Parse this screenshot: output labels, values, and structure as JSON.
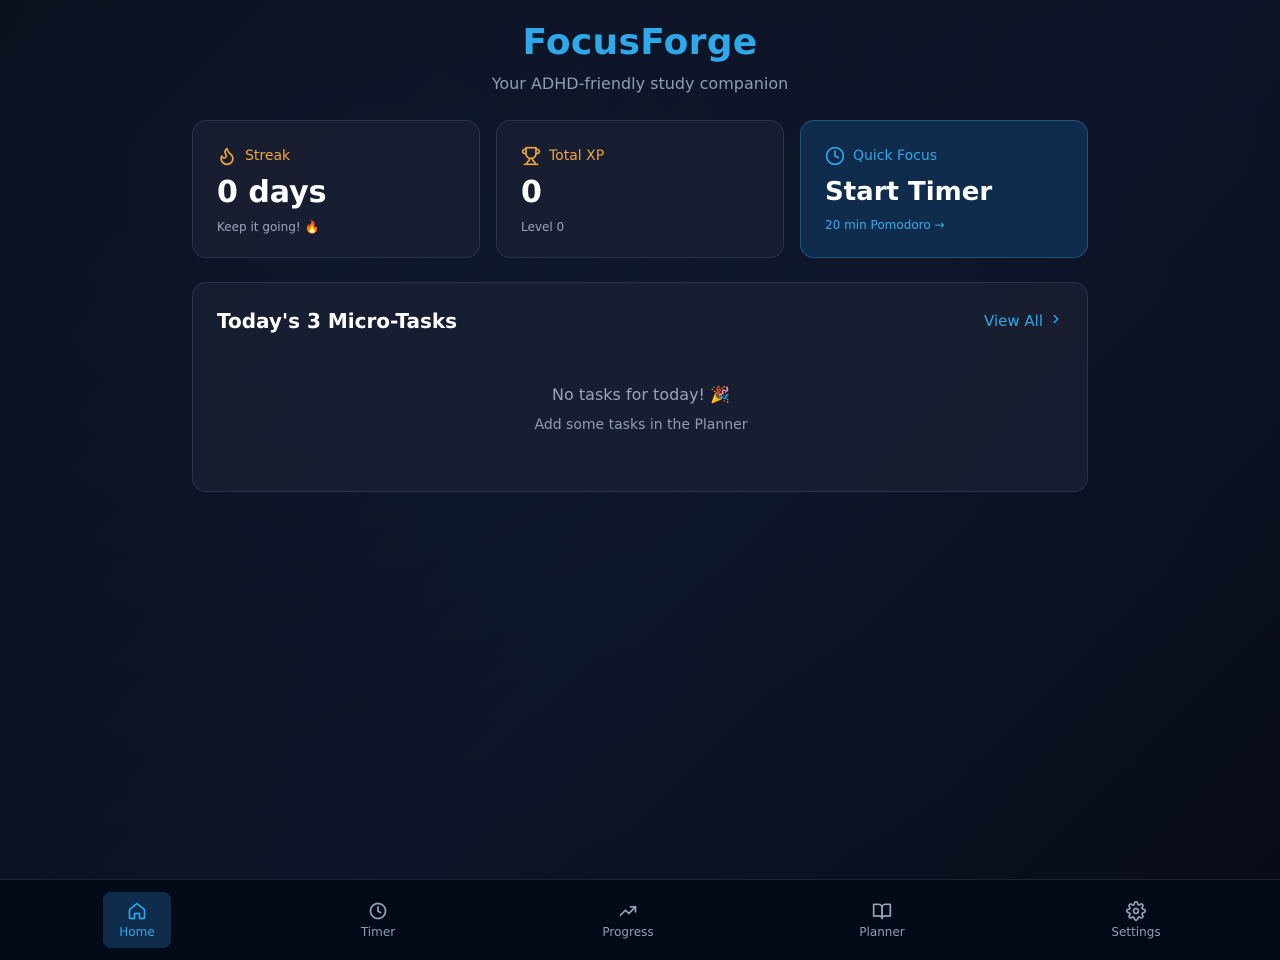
{
  "header": {
    "title": "FocusForge",
    "subtitle": "Your ADHD-friendly study companion"
  },
  "cards": {
    "streak": {
      "icon": "flame-icon",
      "label": "Streak",
      "value": "0 days",
      "note": "Keep it going! 🔥",
      "color": "#f0a43a"
    },
    "xp": {
      "icon": "trophy-icon",
      "label": "Total XP",
      "value": "0",
      "note": "Level 0",
      "color": "#f0a43a"
    },
    "focus": {
      "icon": "clock-icon",
      "label": "Quick Focus",
      "value": "Start Timer",
      "note": "20 min Pomodoro →",
      "color": "#2ea8e8"
    }
  },
  "tasks": {
    "title": "Today's 3 Micro-Tasks",
    "view_all": "View All",
    "empty_main": "No tasks for today! 🎉",
    "empty_sub": "Add some tasks in the Planner"
  },
  "nav": {
    "items": [
      {
        "icon": "home-icon",
        "label": "Home",
        "active": true
      },
      {
        "icon": "clock-icon",
        "label": "Timer",
        "active": false
      },
      {
        "icon": "trending-up-icon",
        "label": "Progress",
        "active": false
      },
      {
        "icon": "book-open-icon",
        "label": "Planner",
        "active": false
      },
      {
        "icon": "gear-icon",
        "label": "Settings",
        "active": false
      }
    ]
  },
  "colors": {
    "accent": "#2ea8e8",
    "warm": "#f0a43a",
    "background": "#0c1222"
  }
}
